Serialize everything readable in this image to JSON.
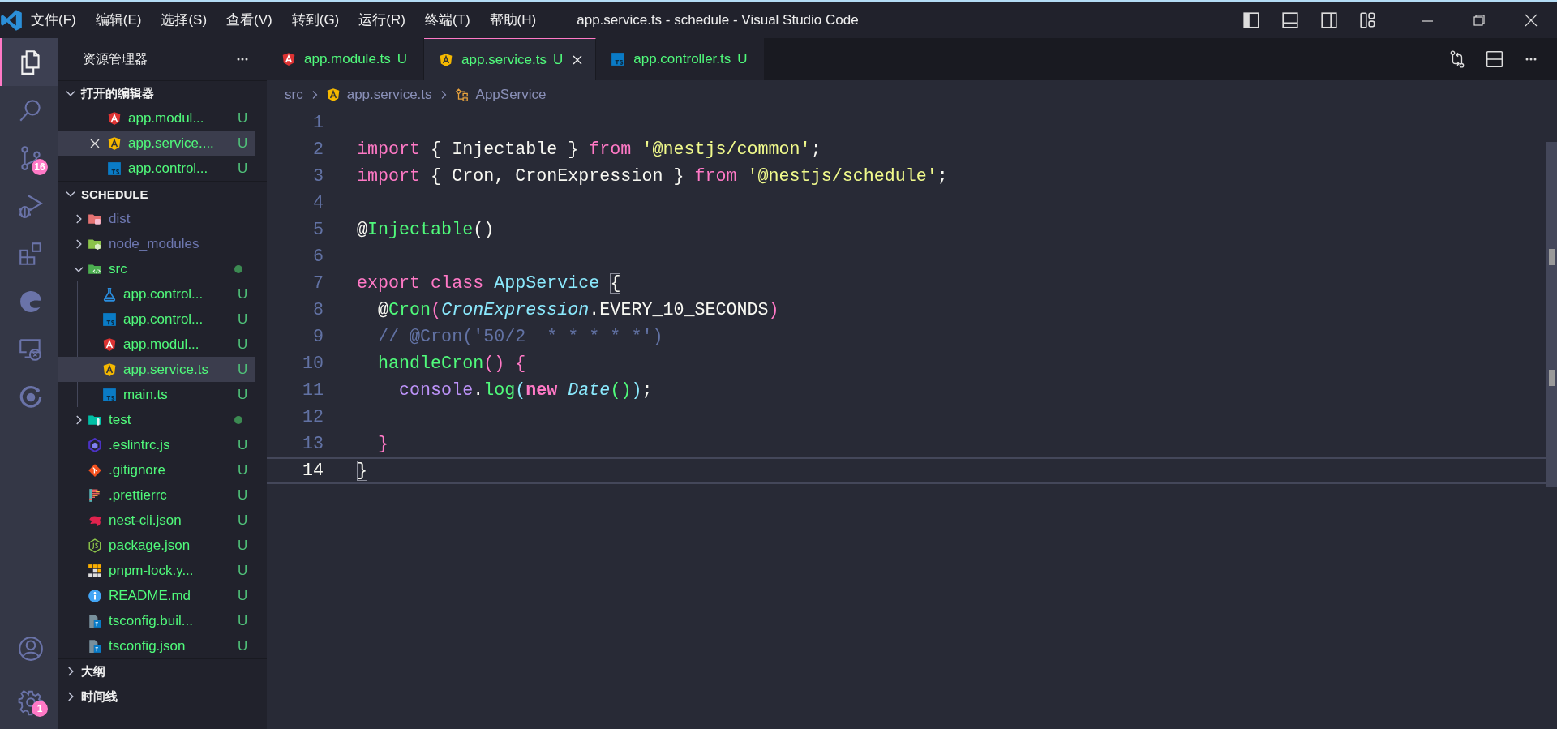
{
  "titlebar": {
    "menus": [
      "文件(F)",
      "编辑(E)",
      "选择(S)",
      "查看(V)",
      "转到(G)",
      "运行(R)",
      "终端(T)",
      "帮助(H)"
    ],
    "title": "app.service.ts - schedule - Visual Studio Code"
  },
  "activity": {
    "top": [
      {
        "kind": "explorer",
        "selected": true
      },
      {
        "kind": "search",
        "selected": false
      },
      {
        "kind": "source-control",
        "selected": false,
        "badge": "16"
      },
      {
        "kind": "run-debug",
        "selected": false
      },
      {
        "kind": "extensions",
        "selected": false
      },
      {
        "kind": "swirl",
        "selected": false
      },
      {
        "kind": "remote",
        "selected": false
      },
      {
        "kind": "ring",
        "selected": false
      }
    ],
    "bottom": [
      {
        "kind": "account",
        "selected": false
      },
      {
        "kind": "settings",
        "selected": false,
        "badge": "1"
      }
    ]
  },
  "sidebar": {
    "title": "资源管理器",
    "sections": [
      {
        "title": "打开的编辑器",
        "expanded": true,
        "items": [
          {
            "name": "app.modul...",
            "kind": "angular",
            "ignored": false,
            "status": "U",
            "selected": false
          },
          {
            "name": "app.service....",
            "kind": "angular-service",
            "ignored": false,
            "status": "U",
            "selected": true
          },
          {
            "name": "app.control...",
            "kind": "typescript",
            "ignored": false,
            "status": "U",
            "selected": false
          }
        ]
      },
      {
        "title": "SCHEDULE",
        "expanded": true,
        "items": [
          {
            "name": "dist",
            "kind": "folder-dist",
            "ignored": true,
            "expanded": false,
            "selected": false
          },
          {
            "name": "node_modules",
            "kind": "folder-node",
            "ignored": true,
            "expanded": false,
            "selected": false
          },
          {
            "name": "src",
            "kind": "folder-src",
            "ignored": false,
            "expanded": true,
            "dot": true,
            "selected": false,
            "children": [
              {
                "name": "app.control...",
                "kind": "test",
                "ignored": false,
                "status": "U",
                "selected": false
              },
              {
                "name": "app.control...",
                "kind": "typescript",
                "ignored": false,
                "status": "U",
                "selected": false
              },
              {
                "name": "app.modul...",
                "kind": "angular",
                "ignored": false,
                "status": "U",
                "selected": false
              },
              {
                "name": "app.service.ts",
                "kind": "angular-service",
                "ignored": false,
                "status": "U",
                "selected": true
              },
              {
                "name": "main.ts",
                "kind": "typescript",
                "ignored": false,
                "status": "U",
                "selected": false
              }
            ]
          },
          {
            "name": "test",
            "kind": "folder-test",
            "ignored": false,
            "expanded": false,
            "dot": true,
            "selected": false
          },
          {
            "name": ".eslintrc.js",
            "kind": "eslint",
            "ignored": false,
            "status": "U",
            "selected": false
          },
          {
            "name": ".gitignore",
            "kind": "git",
            "ignored": false,
            "status": "U",
            "selected": false
          },
          {
            "name": ".prettierrc",
            "kind": "prettier",
            "ignored": false,
            "status": "U",
            "selected": false
          },
          {
            "name": "nest-cli.json",
            "kind": "nest",
            "ignored": false,
            "status": "U",
            "selected": false
          },
          {
            "name": "package.json",
            "kind": "package",
            "ignored": false,
            "status": "U",
            "selected": false
          },
          {
            "name": "pnpm-lock.y...",
            "kind": "pnpm",
            "ignored": false,
            "status": "U",
            "selected": false
          },
          {
            "name": "README.md",
            "kind": "readme",
            "ignored": false,
            "status": "U",
            "selected": false
          },
          {
            "name": "tsconfig.buil...",
            "kind": "tsconfig",
            "ignored": false,
            "status": "U",
            "selected": false
          },
          {
            "name": "tsconfig.json",
            "kind": "tsconfig",
            "ignored": false,
            "status": "U",
            "selected": false
          }
        ]
      },
      {
        "title": "大纲",
        "expanded": false
      },
      {
        "title": "时间线",
        "expanded": false
      }
    ]
  },
  "tabs": [
    {
      "label": "app.module.ts",
      "kind": "angular",
      "status": "U",
      "selected": false
    },
    {
      "label": "app.service.ts",
      "kind": "angular-service",
      "status": "U",
      "selected": true
    },
    {
      "label": "app.controller.ts",
      "kind": "typescript",
      "status": "U",
      "selected": false
    }
  ],
  "breadcrumb": [
    {
      "text": "src"
    },
    {
      "text": "app.service.ts",
      "kind": "angular-service"
    },
    {
      "text": "AppService",
      "kind": "class"
    }
  ],
  "code": {
    "lines": [
      {
        "number": "1"
      },
      {
        "number": "2",
        "tokens": [
          {
            "text": "import",
            "kind": "keyword"
          },
          {
            "text": " { Injectable } ",
            "kind": "plain"
          },
          {
            "text": "from",
            "kind": "keyword"
          },
          {
            "text": " '@nestjs/common'",
            "kind": "string"
          },
          {
            "text": ";",
            "kind": "plain"
          }
        ]
      },
      {
        "number": "3",
        "tokens": [
          {
            "text": "import",
            "kind": "keyword"
          },
          {
            "text": " { Cron, CronExpression } ",
            "kind": "plain"
          },
          {
            "text": "from",
            "kind": "keyword"
          },
          {
            "text": " '@nestjs/schedule'",
            "kind": "string"
          },
          {
            "text": ";",
            "kind": "plain"
          }
        ]
      },
      {
        "number": "4"
      },
      {
        "number": "5",
        "tokens": [
          {
            "text": "@",
            "kind": "plain"
          },
          {
            "text": "Injectable",
            "kind": "function"
          },
          {
            "text": "()",
            "kind": "plain"
          }
        ]
      },
      {
        "number": "6"
      },
      {
        "number": "7",
        "tokens": [
          {
            "text": "export class",
            "kind": "keyword"
          },
          {
            "text": " AppService ",
            "kind": "type"
          },
          {
            "text": "{",
            "kind": "bracket-match"
          }
        ]
      },
      {
        "number": "8",
        "tokens": [
          {
            "text": "  @",
            "kind": "plain"
          },
          {
            "text": "Cron",
            "kind": "function"
          },
          {
            "text": "(",
            "kind": "bracket1"
          },
          {
            "text": "CronExpression",
            "kind": "type-italic"
          },
          {
            "text": ".EVERY_10_SECONDS",
            "kind": "plain"
          },
          {
            "text": ")",
            "kind": "bracket1"
          }
        ]
      },
      {
        "number": "9",
        "tokens": [
          {
            "text": "  // @Cron('50/2  * * * * *')",
            "kind": "comment"
          }
        ]
      },
      {
        "number": "10",
        "tokens": [
          {
            "text": "  handleCron",
            "kind": "function"
          },
          {
            "text": "() {",
            "kind": "bracket1"
          }
        ]
      },
      {
        "number": "11",
        "tokens": [
          {
            "text": "    console",
            "kind": "variable"
          },
          {
            "text": ".",
            "kind": "plain"
          },
          {
            "text": "log",
            "kind": "function"
          },
          {
            "text": "(",
            "kind": "bracket2"
          },
          {
            "text": "new",
            "kind": "keyword-bold"
          },
          {
            "text": " Date",
            "kind": "type-italic"
          },
          {
            "text": "()",
            "kind": "bracket3"
          },
          {
            "text": ")",
            "kind": "bracket2"
          },
          {
            "text": ";",
            "kind": "plain"
          }
        ]
      },
      {
        "number": "12"
      },
      {
        "number": "13",
        "tokens": [
          {
            "text": "  }",
            "kind": "bracket1"
          }
        ]
      },
      {
        "number": "14",
        "current": true,
        "tokens": [
          {
            "text": "}",
            "kind": "bracket-match"
          }
        ]
      }
    ]
  }
}
